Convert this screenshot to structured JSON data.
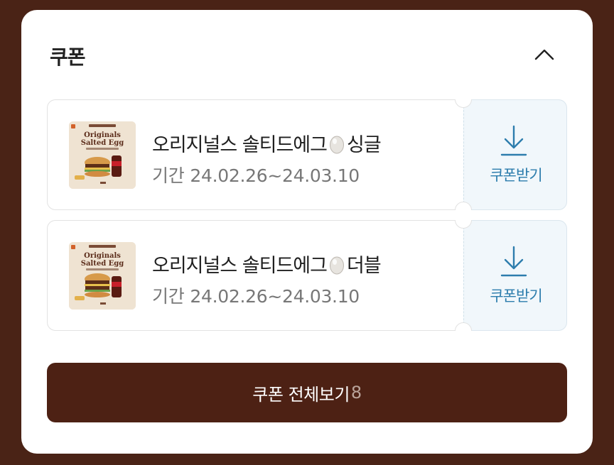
{
  "section": {
    "title": "쿠폰"
  },
  "coupons": [
    {
      "name": "오리지널스 솔티드에그",
      "variant": "싱글",
      "period_label": "기간",
      "period": "24.02.26~24.03.10",
      "thumb_title_line1": "Originals",
      "thumb_title_line2": "Salted Egg",
      "download_label": "쿠폰받기"
    },
    {
      "name": "오리지널스 솔티드에그",
      "variant": "더블",
      "period_label": "기간",
      "period": "24.02.26~24.03.10",
      "thumb_title_line1": "Originals",
      "thumb_title_line2": "Salted Egg",
      "download_label": "쿠폰받기"
    }
  ],
  "view_all": {
    "label": "쿠폰 전체보기",
    "count": "8"
  },
  "colors": {
    "background": "#4a2316",
    "button": "#4d2114",
    "download_text": "#2d7dad",
    "download_bg": "#f1f7fb"
  },
  "icons": {
    "collapse": "chevron-up-icon",
    "download": "download-icon",
    "egg": "egg-icon"
  }
}
